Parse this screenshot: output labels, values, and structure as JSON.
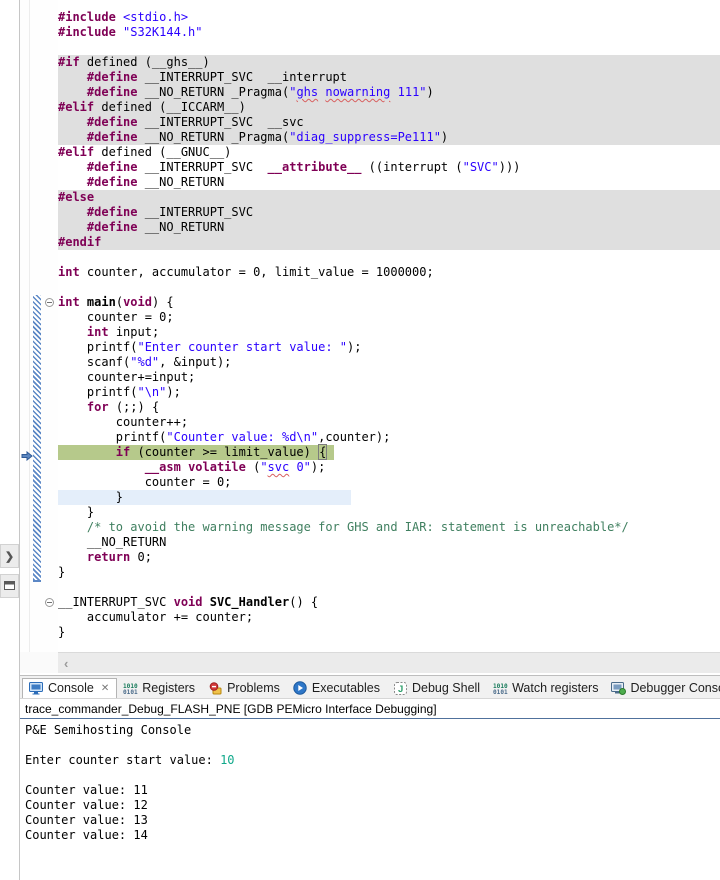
{
  "colors": {
    "keyword": "#7f0055",
    "string": "#2a00ff",
    "comment": "#3f7f5f",
    "inactive_bg": "#dfdfdf",
    "debug_line_bg": "#b6c98b",
    "current_line_bg": "#e4eefa",
    "diff_blue": "#5b87c5",
    "console_input": "#0fa88a",
    "squiggle": "#d86060"
  },
  "icons": {
    "scroll_left_arrow": "‹",
    "restore_view_chevron": "❯",
    "tab_close": "✕"
  },
  "editor": {
    "pointer_line": 30,
    "fold_lines": [
      20,
      40
    ],
    "hatch": {
      "from": 20,
      "to": 38
    },
    "lines": [
      {
        "bg": "",
        "seg": [
          [
            "k",
            "#include"
          ],
          [
            "p",
            " "
          ],
          [
            "s",
            "<stdio.h>"
          ]
        ]
      },
      {
        "bg": "",
        "seg": [
          [
            "k",
            "#include"
          ],
          [
            "p",
            " "
          ],
          [
            "s",
            "\"S32K144.h\""
          ]
        ]
      },
      {
        "bg": "",
        "seg": []
      },
      {
        "bg": "gray",
        "seg": [
          [
            "k",
            "#if"
          ],
          [
            "p",
            " defined (__ghs__)"
          ]
        ]
      },
      {
        "bg": "gray",
        "seg": [
          [
            "p",
            "    "
          ],
          [
            "k",
            "#define"
          ],
          [
            "p",
            " __INTERRUPT_SVC  __interrupt"
          ]
        ]
      },
      {
        "bg": "gray",
        "seg": [
          [
            "p",
            "    "
          ],
          [
            "k",
            "#define"
          ],
          [
            "p",
            " __NO_RETURN _Pragma("
          ],
          [
            "s",
            "\""
          ],
          [
            "sq",
            "ghs"
          ],
          [
            "s",
            " "
          ],
          [
            "sq",
            "nowarning"
          ],
          [
            "s",
            " 111\""
          ],
          [
            "p",
            ")"
          ]
        ]
      },
      {
        "bg": "gray",
        "seg": [
          [
            "k",
            "#elif"
          ],
          [
            "p",
            " defined (__ICCARM__)"
          ]
        ]
      },
      {
        "bg": "gray",
        "seg": [
          [
            "p",
            "    "
          ],
          [
            "k",
            "#define"
          ],
          [
            "p",
            " __INTERRUPT_SVC  __svc"
          ]
        ]
      },
      {
        "bg": "gray",
        "seg": [
          [
            "p",
            "    "
          ],
          [
            "k",
            "#define"
          ],
          [
            "p",
            " __NO_RETURN _Pragma("
          ],
          [
            "s",
            "\"diag_suppress=Pe111\""
          ],
          [
            "p",
            ")"
          ]
        ]
      },
      {
        "bg": "",
        "seg": [
          [
            "k",
            "#elif"
          ],
          [
            "p",
            " defined (__GNUC__)"
          ]
        ]
      },
      {
        "bg": "",
        "seg": [
          [
            "p",
            "    "
          ],
          [
            "k",
            "#define"
          ],
          [
            "p",
            " __INTERRUPT_SVC  "
          ],
          [
            "k",
            "__attribute__"
          ],
          [
            "p",
            " ((interrupt ("
          ],
          [
            "s",
            "\"SVC\""
          ],
          [
            "p",
            ")))"
          ]
        ]
      },
      {
        "bg": "",
        "seg": [
          [
            "p",
            "    "
          ],
          [
            "k",
            "#define"
          ],
          [
            "p",
            " __NO_RETURN"
          ]
        ]
      },
      {
        "bg": "gray",
        "seg": [
          [
            "k",
            "#else"
          ]
        ]
      },
      {
        "bg": "gray",
        "seg": [
          [
            "p",
            "    "
          ],
          [
            "k",
            "#define"
          ],
          [
            "p",
            " __INTERRUPT_SVC"
          ]
        ]
      },
      {
        "bg": "gray",
        "seg": [
          [
            "p",
            "    "
          ],
          [
            "k",
            "#define"
          ],
          [
            "p",
            " __NO_RETURN"
          ]
        ]
      },
      {
        "bg": "gray",
        "seg": [
          [
            "k",
            "#endif"
          ]
        ]
      },
      {
        "bg": "",
        "seg": []
      },
      {
        "bg": "",
        "seg": [
          [
            "k",
            "int"
          ],
          [
            "p",
            " counter, accumulator = 0, limit_value = 1000000;"
          ]
        ]
      },
      {
        "bg": "",
        "seg": []
      },
      {
        "bg": "",
        "seg": [
          [
            "k",
            "int"
          ],
          [
            "p",
            " "
          ],
          [
            "b",
            "main"
          ],
          [
            "p",
            "("
          ],
          [
            "k",
            "void"
          ],
          [
            "p",
            ") {"
          ]
        ]
      },
      {
        "bg": "",
        "seg": [
          [
            "p",
            "    counter = 0;"
          ]
        ]
      },
      {
        "bg": "",
        "seg": [
          [
            "p",
            "    "
          ],
          [
            "k",
            "int"
          ],
          [
            "p",
            " input;"
          ]
        ]
      },
      {
        "bg": "",
        "seg": [
          [
            "p",
            "    printf("
          ],
          [
            "s",
            "\"Enter counter start value: \""
          ],
          [
            "p",
            ");"
          ]
        ]
      },
      {
        "bg": "",
        "seg": [
          [
            "p",
            "    scanf("
          ],
          [
            "s",
            "\"%d\""
          ],
          [
            "p",
            ", &input);"
          ]
        ]
      },
      {
        "bg": "",
        "seg": [
          [
            "p",
            "    counter+=input;"
          ]
        ]
      },
      {
        "bg": "",
        "seg": [
          [
            "p",
            "    printf("
          ],
          [
            "s",
            "\"\\n\""
          ],
          [
            "p",
            ");"
          ]
        ]
      },
      {
        "bg": "",
        "seg": [
          [
            "p",
            "    "
          ],
          [
            "k",
            "for"
          ],
          [
            "p",
            " (;;) {"
          ]
        ]
      },
      {
        "bg": "",
        "seg": [
          [
            "p",
            "        counter++;"
          ]
        ]
      },
      {
        "bg": "",
        "seg": [
          [
            "p",
            "        printf("
          ],
          [
            "s",
            "\"Counter value: %d\\n\""
          ],
          [
            "p",
            ",counter);"
          ]
        ]
      },
      {
        "bg": "green",
        "seg": [
          [
            "p",
            "        "
          ],
          [
            "k",
            "if"
          ],
          [
            "p",
            " (counter >= limit_value) "
          ],
          [
            "br",
            "{"
          ]
        ]
      },
      {
        "bg": "",
        "seg": [
          [
            "p",
            "            "
          ],
          [
            "k",
            "__asm"
          ],
          [
            "p",
            " "
          ],
          [
            "k",
            "volatile"
          ],
          [
            "p",
            " ("
          ],
          [
            "s",
            "\""
          ],
          [
            "sq",
            "svc"
          ],
          [
            "s",
            " 0\""
          ],
          [
            "p",
            ");"
          ]
        ]
      },
      {
        "bg": "",
        "seg": [
          [
            "p",
            "            counter = 0;"
          ]
        ]
      },
      {
        "bg": "blue",
        "seg": [
          [
            "p",
            "        }"
          ]
        ]
      },
      {
        "bg": "",
        "seg": [
          [
            "p",
            "    }"
          ]
        ]
      },
      {
        "bg": "",
        "seg": [
          [
            "p",
            "    "
          ],
          [
            "c",
            "/* to avoid the warning message for GHS and IAR: statement is unreachable*/"
          ]
        ]
      },
      {
        "bg": "",
        "seg": [
          [
            "p",
            "    __NO_RETURN"
          ]
        ]
      },
      {
        "bg": "",
        "seg": [
          [
            "p",
            "    "
          ],
          [
            "k",
            "return"
          ],
          [
            "p",
            " 0;"
          ]
        ]
      },
      {
        "bg": "",
        "seg": [
          [
            "p",
            "}"
          ]
        ]
      },
      {
        "bg": "",
        "seg": []
      },
      {
        "bg": "",
        "seg": [
          [
            "p",
            "__INTERRUPT_SVC "
          ],
          [
            "k",
            "void"
          ],
          [
            "p",
            " "
          ],
          [
            "b",
            "SVC_Handler"
          ],
          [
            "p",
            "() {"
          ]
        ]
      },
      {
        "bg": "",
        "seg": [
          [
            "p",
            "    accumulator += counter;"
          ]
        ]
      },
      {
        "bg": "",
        "seg": [
          [
            "p",
            "}"
          ]
        ]
      }
    ]
  },
  "console": {
    "tabs": [
      {
        "label": "Console",
        "icon": "console-icon",
        "selected": true,
        "closable": true
      },
      {
        "label": "Registers",
        "icon": "registers-icon",
        "selected": false,
        "closable": false
      },
      {
        "label": "Problems",
        "icon": "problems-icon",
        "selected": false,
        "closable": false
      },
      {
        "label": "Executables",
        "icon": "executables-icon",
        "selected": false,
        "closable": false
      },
      {
        "label": "Debug Shell",
        "icon": "debug-shell-icon",
        "selected": false,
        "closable": false
      },
      {
        "label": "Watch registers",
        "icon": "watch-registers-icon",
        "selected": false,
        "closable": false
      },
      {
        "label": "Debugger Console",
        "icon": "debugger-console-icon",
        "selected": false,
        "closable": false
      },
      {
        "label": "",
        "icon": "memory-icon",
        "selected": false,
        "closable": false
      }
    ],
    "title": "trace_commander_Debug_FLASH_PNE [GDB PEMicro Interface Debugging]",
    "lines": [
      [
        [
          "out",
          "P&E Semihosting Console"
        ]
      ],
      [],
      [
        [
          "out",
          "Enter counter start value: "
        ],
        [
          "in",
          "10"
        ]
      ],
      [],
      [
        [
          "out",
          "Counter value: 11"
        ]
      ],
      [
        [
          "out",
          "Counter value: 12"
        ]
      ],
      [
        [
          "out",
          "Counter value: 13"
        ]
      ],
      [
        [
          "out",
          "Counter value: 14"
        ]
      ]
    ]
  }
}
